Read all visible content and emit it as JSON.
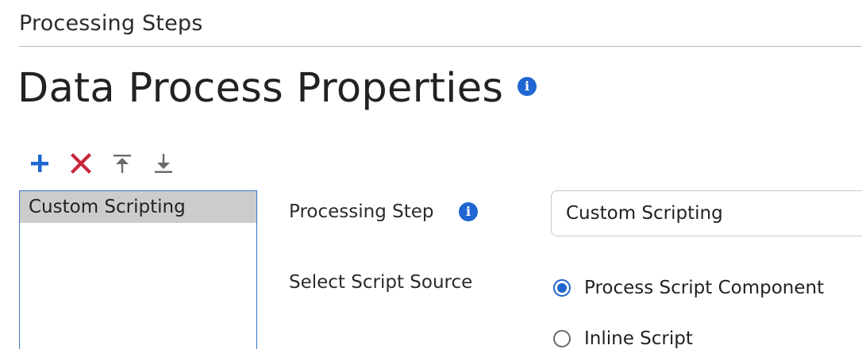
{
  "section": {
    "title": "Processing Steps"
  },
  "page": {
    "title": "Data Process Properties",
    "info_icon": "info-icon"
  },
  "toolbar": {
    "add_icon": "plus-icon",
    "delete_icon": "x-icon",
    "move_top_icon": "move-to-top-icon",
    "move_bottom_icon": "move-to-bottom-icon"
  },
  "steps_list": {
    "items": [
      {
        "label": "Custom Scripting",
        "selected": true
      }
    ]
  },
  "form": {
    "processing_step": {
      "label": "Processing Step",
      "value": "Custom Scripting",
      "info_icon": "info-icon"
    },
    "script_source": {
      "label": "Select Script Source",
      "options": [
        {
          "label": "Process Script Component",
          "checked": true
        },
        {
          "label": "Inline Script",
          "checked": false
        }
      ]
    }
  },
  "colors": {
    "accent_blue": "#1f66d1",
    "delete_red": "#c8283c",
    "selected_row": "#cccccc",
    "list_border": "#3a73c8",
    "icon_gray": "#6a6a6a"
  }
}
